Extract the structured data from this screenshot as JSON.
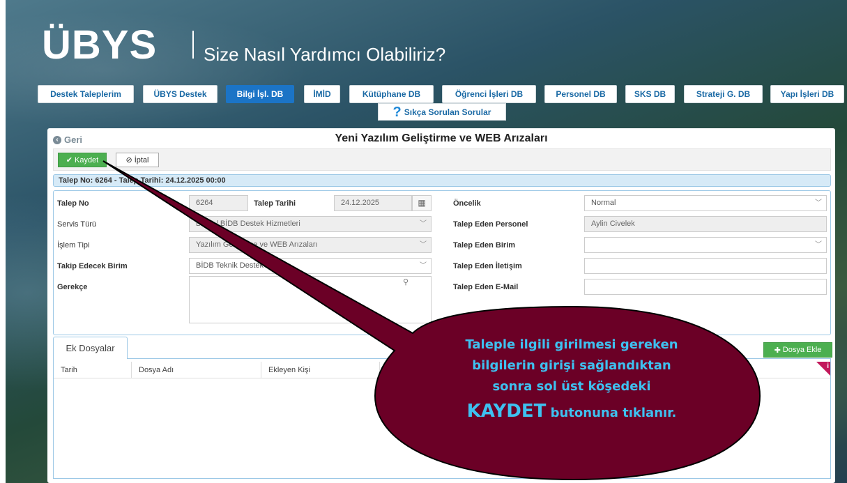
{
  "header": {
    "logo": "ÜBYS",
    "slogan": "Size Nasıl Yardımcı Olabiliriz?"
  },
  "nav": {
    "items": [
      {
        "label": "Destek Taleplerim",
        "active": false
      },
      {
        "label": "ÜBYS Destek",
        "active": false
      },
      {
        "label": "Bilgi İşl. DB",
        "active": true
      },
      {
        "label": "İMİD",
        "active": false
      },
      {
        "label": "Kütüphane DB",
        "active": false
      },
      {
        "label": "Öğrenci İşleri DB",
        "active": false
      },
      {
        "label": "Personel DB",
        "active": false
      },
      {
        "label": "SKS DB",
        "active": false
      },
      {
        "label": "Strateji G. DB",
        "active": false
      },
      {
        "label": "Yapı İşleri DB",
        "active": false
      }
    ],
    "faq": "Sıkça Sorulan Sorular"
  },
  "page": {
    "back": "Geri",
    "title": "Yeni Yazılım Geliştirme ve WEB Arızaları",
    "save": "Kaydet",
    "cancel": "İptal",
    "info": "Talep No: 6264 - Talep Tarihi: 24.12.2025 00:00"
  },
  "form": {
    "talep_no_label": "Talep No",
    "talep_no": "6264",
    "talep_tarihi_label": "Talep Tarihi",
    "talep_tarihi": "24.12.2025",
    "servis_turu_label": "Servis Türü",
    "servis_turu": "BİDB / BİDB Destek Hizmetleri",
    "islem_tipi_label": "İşlem Tipi",
    "islem_tipi": "Yazılım Geliştirme ve WEB Arızaları",
    "takip_birim_label": "Takip Edecek Birim",
    "takip_birim": "BİDB Teknik Destek Birimi",
    "gerekce_label": "Gerekçe",
    "oncelik_label": "Öncelik",
    "oncelik": "Normal",
    "personel_label": "Talep Eden Personel",
    "personel": "Aylin Civelek",
    "birim_label": "Talep Eden Birim",
    "birim": "",
    "iletisim_label": "Talep Eden İletişim",
    "iletisim": "",
    "email_label": "Talep Eden E-Mail",
    "email": ""
  },
  "files": {
    "tab": "Ek Dosyalar",
    "add": "Dosya Ekle",
    "columns": [
      "Tarih",
      "Dosya Adı",
      "Ekleyen Kişi"
    ]
  },
  "callout": {
    "line1": "Taleple ilgili girilmesi gereken",
    "line2": "bilgilerin girişi sağlandıktan",
    "line3": "sonra sol üst köşedeki",
    "strong": "KAYDET",
    "line4": " butonuna tıklanır.",
    "fill": "#6b0026",
    "text_color": "#3ec1f0"
  }
}
